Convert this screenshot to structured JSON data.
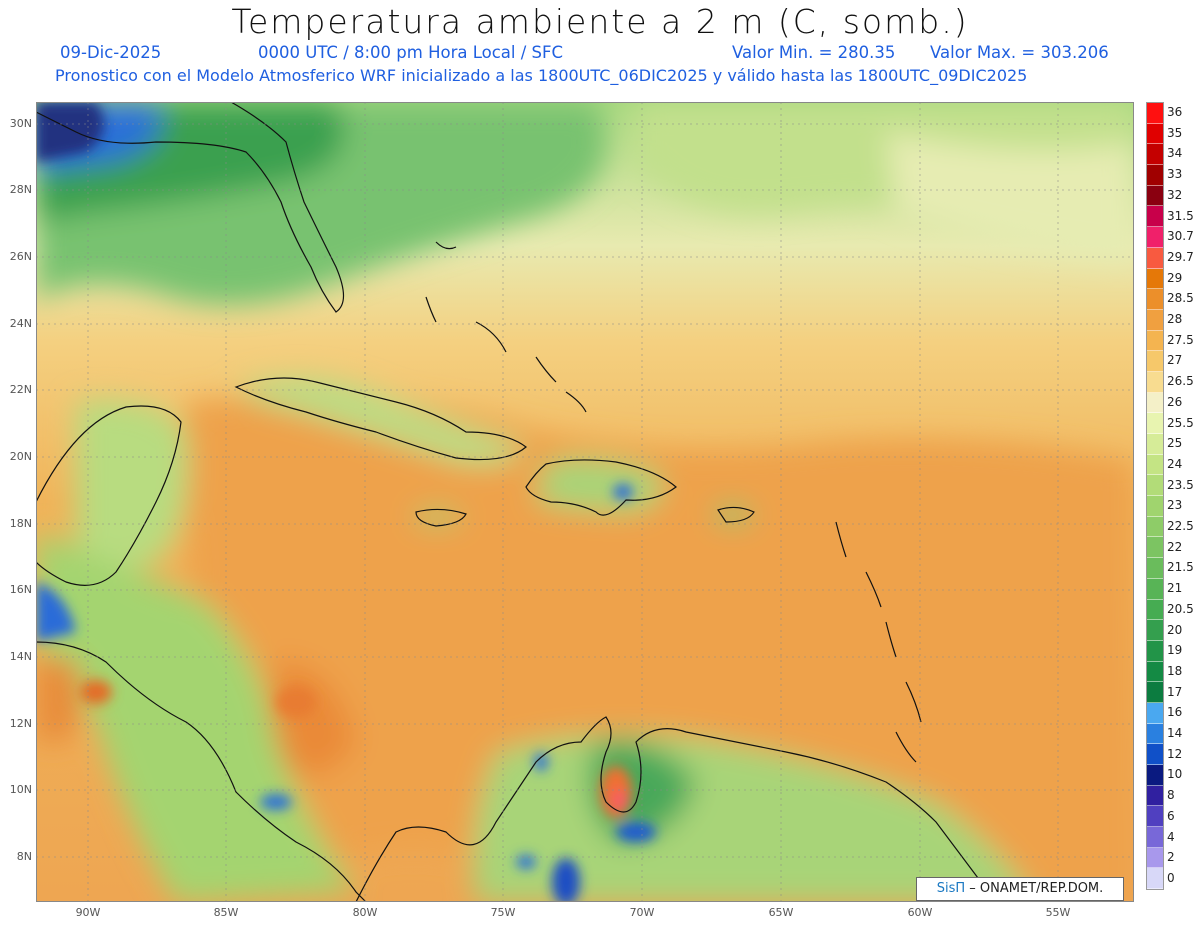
{
  "header": {
    "title": "Temperatura ambiente a 2 m (C, somb.)",
    "date": "09-Dic-2025",
    "time": "0000 UTC / 8:00 pm Hora Local / SFC",
    "min_value": "Valor Min. = 280.35",
    "max_value": "Valor Max. = 303.206",
    "model_info": "Pronostico con el Modelo Atmosferico WRF inicializado a las 1800UTC_06DIC2025 y válido hasta las  1800UTC_09DIC2025"
  },
  "axes": {
    "latitudes": [
      "30N",
      "28N",
      "26N",
      "24N",
      "22N",
      "20N",
      "18N",
      "16N",
      "14N",
      "12N",
      "10N",
      "8N"
    ],
    "longitudes": [
      "90W",
      "85W",
      "80W",
      "75W",
      "70W",
      "65W",
      "60W",
      "55W"
    ]
  },
  "colorbar": {
    "labels": [
      "36",
      "35",
      "34",
      "33",
      "32",
      "31.5",
      "30.7",
      "29.7",
      "29",
      "28.5",
      "28",
      "27.5",
      "27",
      "26.5",
      "26",
      "25.5",
      "25",
      "24",
      "23.5",
      "23",
      "22.5",
      "22",
      "21.5",
      "21",
      "20.5",
      "20",
      "19",
      "18",
      "17",
      "16",
      "14",
      "12",
      "10",
      "8",
      "6",
      "4",
      "2",
      "0"
    ],
    "colors": [
      "#ff1010",
      "#e00000",
      "#c40000",
      "#a00000",
      "#8a0010",
      "#c8004a",
      "#f0206a",
      "#f85a40",
      "#e57808",
      "#ec8f2a",
      "#f0a040",
      "#f4b450",
      "#f6c86a",
      "#f8dc90",
      "#f4f0c8",
      "#e8f4b0",
      "#d6ec98",
      "#c4e484",
      "#b2dc78",
      "#a0d46e",
      "#8ecc68",
      "#7cc462",
      "#6abc5c",
      "#58b456",
      "#46ac52",
      "#349f4e",
      "#229448",
      "#148a44",
      "#0c7c40",
      "#4aa8f0",
      "#2a80e0",
      "#1050c8",
      "#0a1a80",
      "#3020a0",
      "#5040c0",
      "#7868d8",
      "#a898ec",
      "#d8d8f8"
    ]
  },
  "credit": {
    "brand": "SisΠ",
    "text": "– ONAMET/REP.DOM."
  }
}
